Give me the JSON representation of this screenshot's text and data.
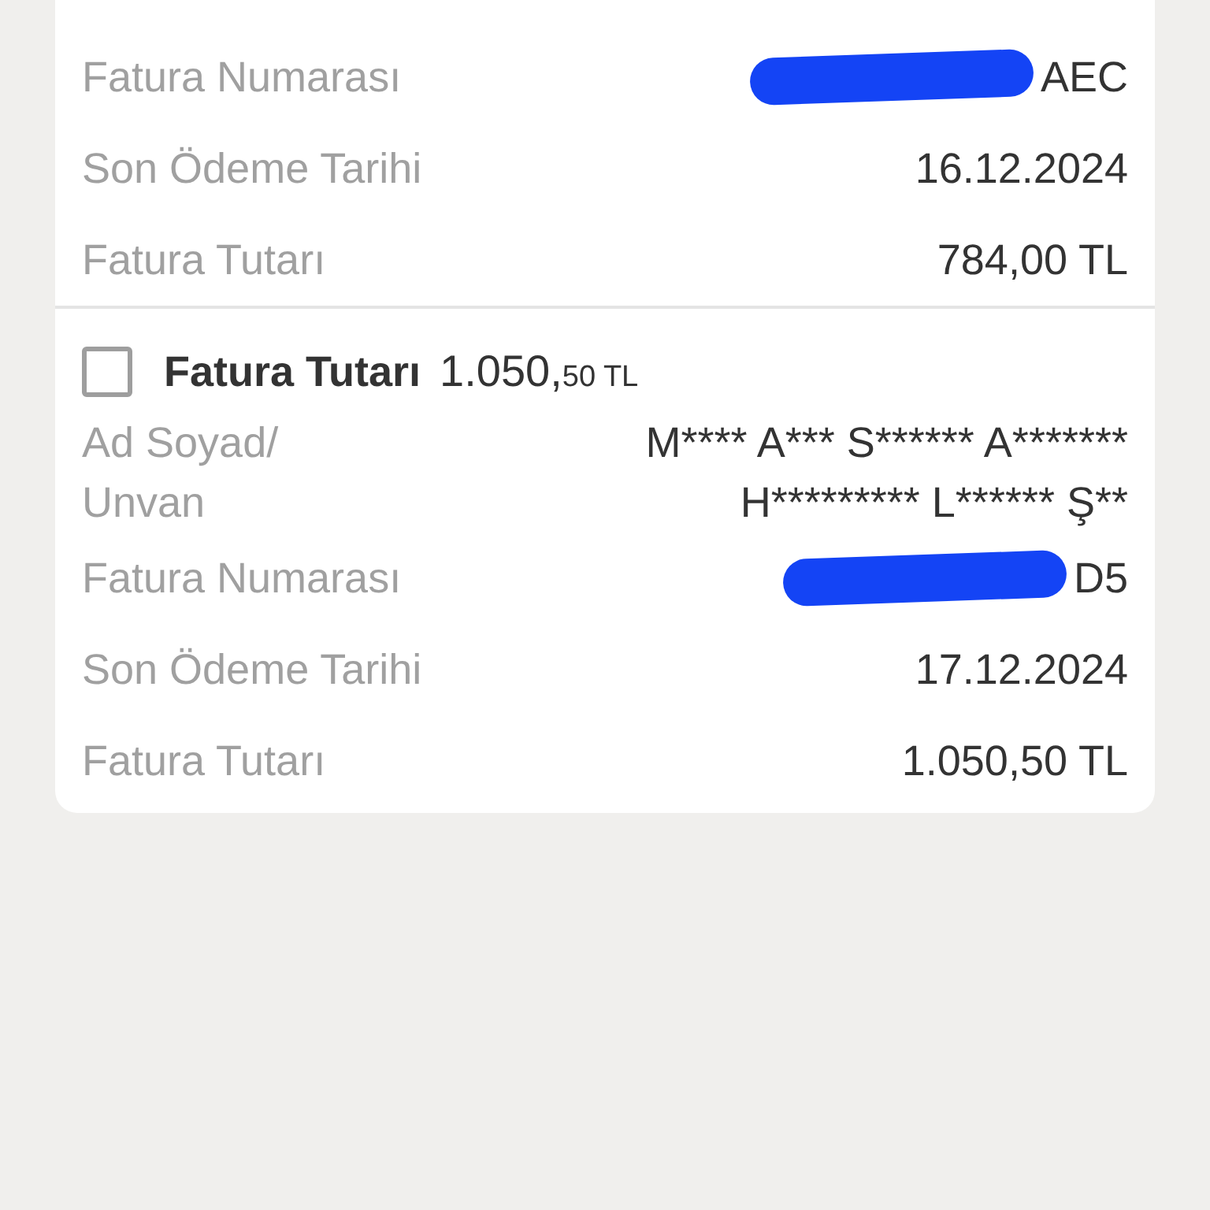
{
  "bills": [
    {
      "rows": [
        {
          "label": "Fatura Numarası",
          "value": "AEC",
          "redacted": true
        },
        {
          "label": "Son Ödeme Tarihi",
          "value": "16.12.2024",
          "redacted": false
        },
        {
          "label": "Fatura Tutarı",
          "value": "784,00 TL",
          "redacted": false
        }
      ]
    },
    {
      "checkbox": {
        "checked": false,
        "title": "Fatura Tutarı",
        "amount_main": "1.050,",
        "amount_small": "50 TL"
      },
      "rows": [
        {
          "label": "Ad Soyad/\nUnvan",
          "value": "M**** A*** S****** A******* H********* L****** Ş**",
          "redacted": false
        },
        {
          "label": "Fatura Numarası",
          "value": "D5",
          "redacted": true
        },
        {
          "label": "Son Ödeme Tarihi",
          "value": "17.12.2024",
          "redacted": false
        },
        {
          "label": "Fatura Tutarı",
          "value": "1.050,50 TL",
          "redacted": false
        }
      ]
    }
  ]
}
